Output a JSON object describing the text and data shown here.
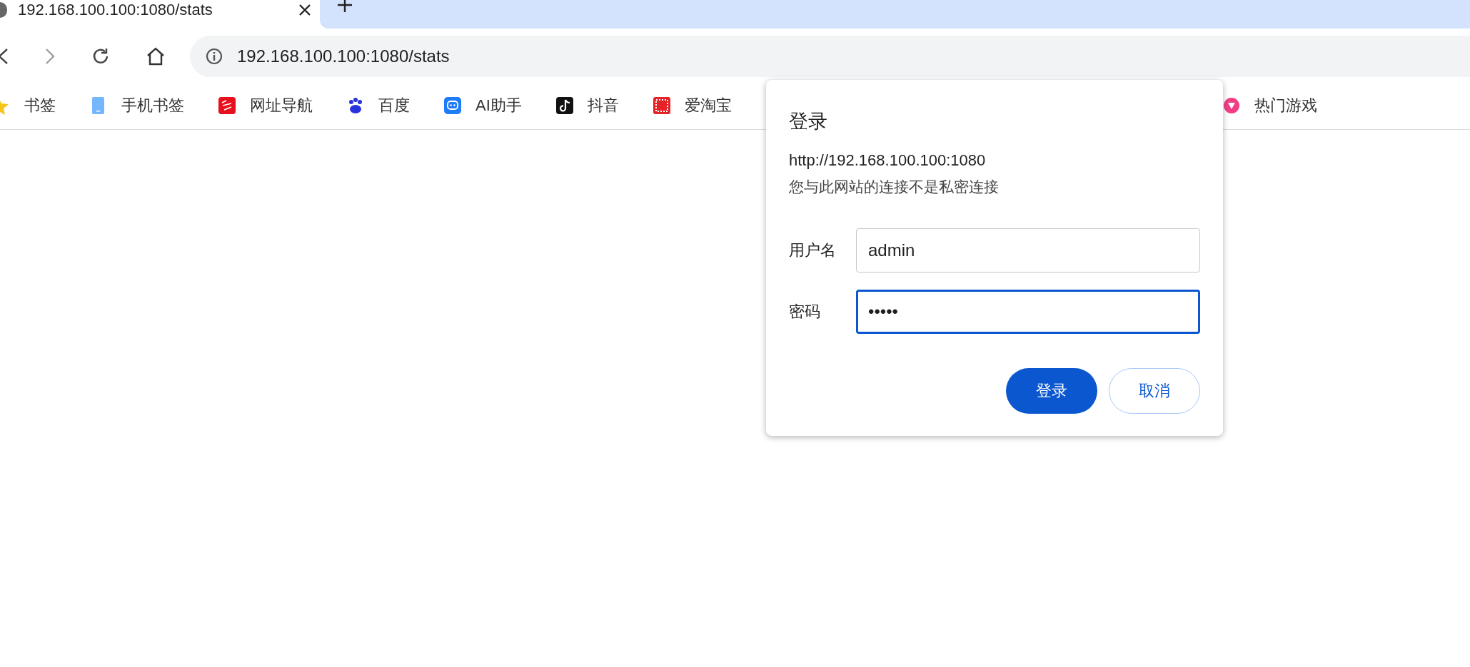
{
  "tab": {
    "title": "192.168.100.100:1080/stats"
  },
  "address_bar": {
    "value": "192.168.100.100:1080/stats"
  },
  "bookmarks": [
    {
      "label": "书签",
      "kind": "star"
    },
    {
      "label": "手机书签",
      "kind": "phone"
    },
    {
      "label": "网址导航",
      "kind": "news"
    },
    {
      "label": "百度",
      "kind": "paw"
    },
    {
      "label": "AI助手",
      "kind": "chat"
    },
    {
      "label": "抖音",
      "kind": "note"
    },
    {
      "label": "爱淘宝",
      "kind": "tao"
    },
    {
      "label": "热门游戏",
      "kind": "game"
    }
  ],
  "dialog": {
    "title": "登录",
    "origin": "http://192.168.100.100:1080",
    "warning": "您与此网站的连接不是私密连接",
    "fields": [
      {
        "label": "用户名",
        "value": "admin",
        "focused": false
      },
      {
        "label": "密码",
        "value": "•••••",
        "focused": true
      }
    ],
    "buttons": [
      {
        "label": "登录",
        "kind": "primary"
      },
      {
        "label": "取消",
        "kind": "secondary"
      }
    ]
  }
}
